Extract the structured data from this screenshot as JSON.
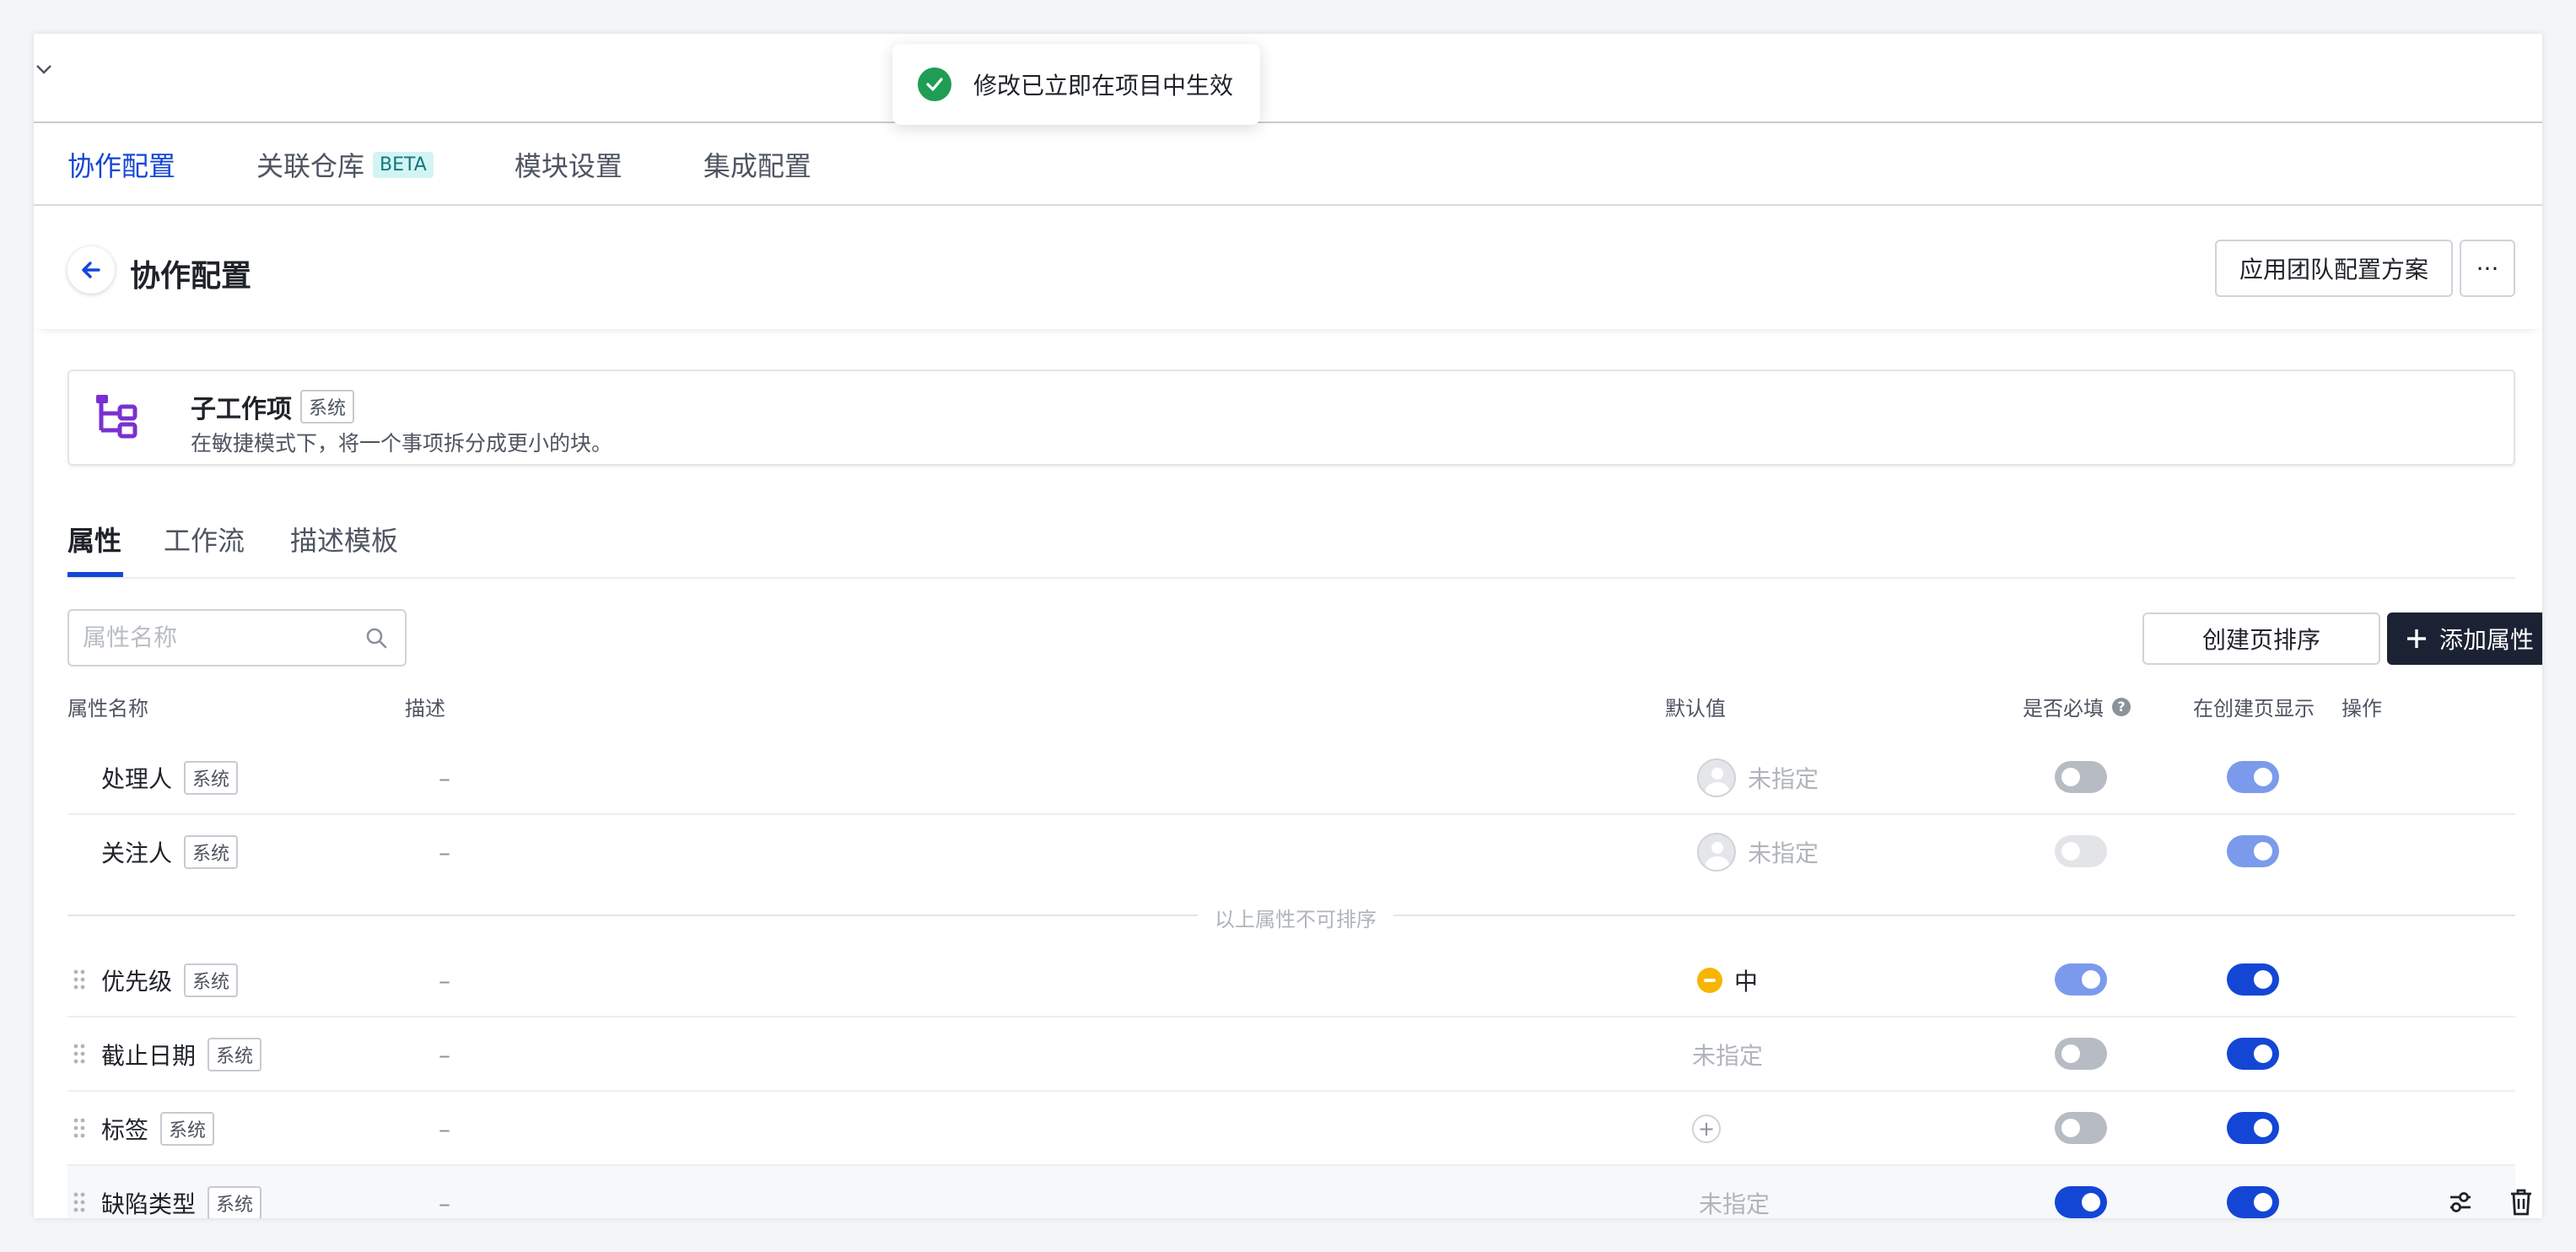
{
  "toast": {
    "message": "修改已立即在项目中生效"
  },
  "main_tabs": [
    {
      "label": "协作配置",
      "active": true
    },
    {
      "label": "关联仓库",
      "badge": "BETA"
    },
    {
      "label": "模块设置"
    },
    {
      "label": "集成配置"
    }
  ],
  "header": {
    "title": "协作配置",
    "apply_button": "应用团队配置方案",
    "more_button": "···"
  },
  "item_type": {
    "name": "子工作项",
    "tag": "系统",
    "description": "在敏捷模式下，将一个事项拆分成更小的块。"
  },
  "sub_tabs": [
    {
      "label": "属性",
      "active": true
    },
    {
      "label": "工作流"
    },
    {
      "label": "描述模板"
    }
  ],
  "toolbar": {
    "search_placeholder": "属性名称",
    "sort_button": "创建页排序",
    "add_button": "添加属性"
  },
  "columns": {
    "name": "属性名称",
    "description": "描述",
    "default": "默认值",
    "required": "是否必填",
    "show_on_create": "在创建页显示",
    "actions": "操作"
  },
  "divider_label": "以上属性不可排序",
  "rows": [
    {
      "name": "处理人",
      "tag": "系统",
      "description": "–",
      "default": "未指定",
      "required": false,
      "required_disabled": false,
      "show": true,
      "show_disabled": true
    },
    {
      "name": "关注人",
      "tag": "系统",
      "description": "–",
      "default": "未指定",
      "required": false,
      "required_disabled": true,
      "show": true,
      "show_disabled": true
    },
    {
      "name": "优先级",
      "tag": "系统",
      "description": "–",
      "default": "中",
      "required": true,
      "required_disabled": true,
      "show": true,
      "show_disabled": false
    },
    {
      "name": "截止日期",
      "tag": "系统",
      "description": "–",
      "default": "未指定",
      "required": false,
      "show": true
    },
    {
      "name": "标签",
      "tag": "系统",
      "description": "–",
      "default": "",
      "required": false,
      "show": true
    },
    {
      "name": "缺陷类型",
      "tag": "系统",
      "description": "–",
      "default": "未指定",
      "required": true,
      "show": true
    }
  ],
  "colors": {
    "accent": "#1446d6",
    "dark_button": "#1b2233",
    "success": "#1f9d55",
    "priority_medium": "#f7b500",
    "item_icon": "#7b2fd0"
  }
}
